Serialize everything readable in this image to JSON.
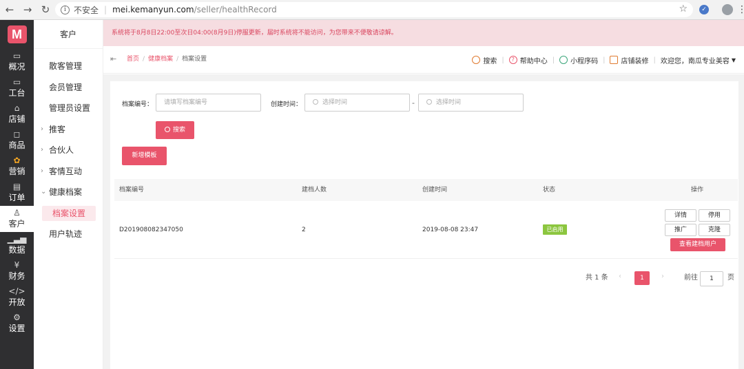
{
  "browser": {
    "back": "←",
    "forward": "→",
    "reload": "↻",
    "insecure_label": "不安全",
    "url_host": "mei.kemanyun.com",
    "url_path": "/seller/healthRecord"
  },
  "rail": {
    "logo": "M",
    "items": [
      {
        "label": "概况",
        "icon": "dashboard-icon"
      },
      {
        "label": "工台",
        "icon": "monitor-icon"
      },
      {
        "label": "店铺",
        "icon": "store-icon"
      },
      {
        "label": "商品",
        "icon": "bag-icon"
      },
      {
        "label": "营销",
        "icon": "flower-icon"
      },
      {
        "label": "订单",
        "icon": "order-icon"
      },
      {
        "label": "客户",
        "icon": "user-icon"
      },
      {
        "label": "数据",
        "icon": "chart-icon"
      },
      {
        "label": "财务",
        "icon": "finance-icon"
      },
      {
        "label": "开放",
        "icon": "code-icon"
      },
      {
        "label": "设置",
        "icon": "gear-icon"
      }
    ]
  },
  "sidebar": {
    "title": "客户",
    "items": [
      {
        "label": "散客管理"
      },
      {
        "label": "会员管理"
      },
      {
        "label": "管理员设置"
      },
      {
        "label": "推客"
      },
      {
        "label": "合伙人"
      },
      {
        "label": "客情互动"
      },
      {
        "label": "健康档案"
      },
      {
        "label": "档案设置"
      },
      {
        "label": "用户轨迹"
      }
    ]
  },
  "notice": "系统将于8月8日22:00至次日04:00(8月9日)停服更新，届时系统将不能访问，为您带来不便敬请谅解。",
  "header": {
    "breadcrumb": [
      "首页",
      "健康档案",
      "档案设置"
    ],
    "search": "搜索",
    "help": "帮助中心",
    "miniapp": "小程序码",
    "decor": "店铺装修",
    "welcome": "欢迎您，南瓜专业美容"
  },
  "filter": {
    "code_label": "档案编号：",
    "code_placeholder": "请填写档案编号",
    "time_label": "创建时间：",
    "start_placeholder": "选择时间",
    "end_placeholder": "选择时间",
    "dash": "-",
    "search_button": "搜索",
    "add_button": "新增模板"
  },
  "table": {
    "columns": [
      "档案编号",
      "建档人数",
      "创建时间",
      "状态",
      "操作"
    ],
    "rows": [
      {
        "code": "D201908082347050",
        "count": "2",
        "created": "2019-08-08 23:47",
        "status": "已启用"
      }
    ],
    "actions": {
      "detail": "详情",
      "disable": "停用",
      "promote": "推广",
      "clone": "克隆",
      "view_users": "查看建档用户"
    }
  },
  "pagination": {
    "total": "共 1 条",
    "current": "1",
    "prev": "‹",
    "next": "›",
    "goto_prefix": "前往",
    "goto_value": "1",
    "goto_suffix": "页"
  },
  "colors": {
    "accent": "#e9546b",
    "rail": "#2f2f31",
    "success": "#8cc63f"
  }
}
